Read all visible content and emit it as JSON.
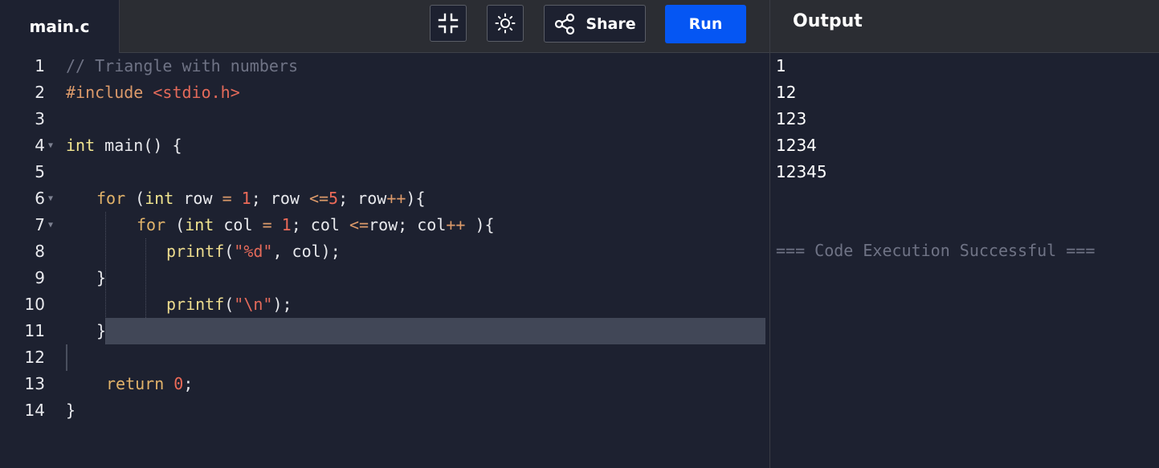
{
  "editor": {
    "file_tab": "main.c",
    "lines": [
      {
        "n": "1",
        "tokens": [
          {
            "t": "// Triangle with numbers",
            "c": "com"
          }
        ]
      },
      {
        "n": "2",
        "tokens": [
          {
            "t": "#include ",
            "c": "pp"
          },
          {
            "t": "<stdio.h>",
            "c": "str"
          }
        ]
      },
      {
        "n": "3",
        "tokens": []
      },
      {
        "n": "4",
        "tokens": [
          {
            "t": "int",
            "c": "type"
          },
          {
            "t": " main() {",
            "c": ""
          }
        ]
      },
      {
        "n": "5",
        "tokens": []
      },
      {
        "n": "6",
        "tokens": [
          {
            "t": "for",
            "c": "kw"
          },
          {
            "t": " (",
            "c": ""
          },
          {
            "t": "int",
            "c": "type"
          },
          {
            "t": " row ",
            "c": ""
          },
          {
            "t": "=",
            "c": "op"
          },
          {
            "t": " ",
            "c": ""
          },
          {
            "t": "1",
            "c": "num"
          },
          {
            "t": "; row ",
            "c": ""
          },
          {
            "t": "<=",
            "c": "op"
          },
          {
            "t": "5",
            "c": "num"
          },
          {
            "t": "; row",
            "c": ""
          },
          {
            "t": "++",
            "c": "op"
          },
          {
            "t": "){",
            "c": ""
          }
        ]
      },
      {
        "n": "7",
        "tokens": [
          {
            "t": "for",
            "c": "kw"
          },
          {
            "t": " (",
            "c": ""
          },
          {
            "t": "int",
            "c": "type"
          },
          {
            "t": " col ",
            "c": ""
          },
          {
            "t": "=",
            "c": "op"
          },
          {
            "t": " ",
            "c": ""
          },
          {
            "t": "1",
            "c": "num"
          },
          {
            "t": "; col ",
            "c": ""
          },
          {
            "t": "<=",
            "c": "op"
          },
          {
            "t": "row; col",
            "c": ""
          },
          {
            "t": "++",
            "c": "op"
          },
          {
            "t": " ){",
            "c": ""
          }
        ]
      },
      {
        "n": "8",
        "tokens": [
          {
            "t": "printf",
            "c": "fn"
          },
          {
            "t": "(",
            "c": ""
          },
          {
            "t": "\"%d\"",
            "c": "str"
          },
          {
            "t": ", col);",
            "c": ""
          }
        ]
      },
      {
        "n": "9",
        "tokens": [
          {
            "t": "}",
            "c": ""
          }
        ]
      },
      {
        "n": "10",
        "tokens": [
          {
            "t": "printf",
            "c": "fn"
          },
          {
            "t": "(",
            "c": ""
          },
          {
            "t": "\"\\n\"",
            "c": "str"
          },
          {
            "t": ");",
            "c": ""
          }
        ]
      },
      {
        "n": "11",
        "tokens": [
          {
            "t": "}",
            "c": ""
          }
        ]
      },
      {
        "n": "12",
        "tokens": []
      },
      {
        "n": "13",
        "tokens": [
          {
            "t": "return",
            "c": "kw"
          },
          {
            "t": " ",
            "c": ""
          },
          {
            "t": "0",
            "c": "num"
          },
          {
            "t": ";",
            "c": ""
          }
        ]
      },
      {
        "n": "14",
        "tokens": [
          {
            "t": "}",
            "c": ""
          }
        ]
      }
    ]
  },
  "toolbar": {
    "fullscreen_icon": "collapse-icon",
    "theme_icon": "sun-icon",
    "share_icon": "share-icon",
    "share_label": "Share",
    "run_label": "Run"
  },
  "output": {
    "title": "Output",
    "lines": [
      "1",
      "12",
      "123",
      "1234",
      "12345"
    ],
    "status": "=== Code Execution Successful ==="
  },
  "colors": {
    "background": "#1d2130",
    "toolbar": "#2b2d33",
    "run_button": "#0556f3",
    "line_highlight": "#414757"
  }
}
